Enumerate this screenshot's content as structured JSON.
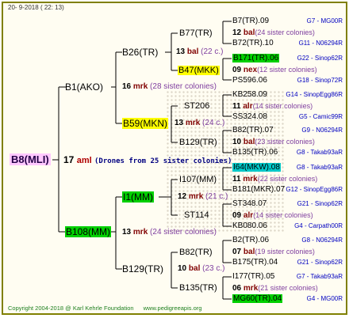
{
  "header": {
    "date": "20-  9-2018",
    "time": "( 22: 13)"
  },
  "root": {
    "name": "B8(MLI)",
    "generation": "17",
    "mark": "aml",
    "info": "(Drones from 25 sister colonies)"
  },
  "level1": [
    {
      "name": "B1(AKO)",
      "generation": "16",
      "mark": "mrk",
      "info": "(28 sister colonies)"
    },
    {
      "name": "B108(MM)",
      "generation": "13",
      "mark": "mrk",
      "info": "(24 sister colonies)"
    }
  ],
  "level2": [
    {
      "name": "B26(TR)",
      "generation": "13",
      "mark": "bal",
      "info": "(22 c.)"
    },
    {
      "name": "B59(MKN)",
      "generation": "13",
      "mark": "mrk",
      "info": "(24 c.)"
    },
    {
      "name": "I1(MM)",
      "generation": "12",
      "mark": "mrk",
      "info": "(21 c.)"
    },
    {
      "name": "B129(TR)",
      "generation": "10",
      "mark": "bal",
      "info": "(23 c.)"
    }
  ],
  "level3": [
    {
      "name": "B77(TR)"
    },
    {
      "name": "B47(MKK)"
    },
    {
      "name": "ST206"
    },
    {
      "name": "B129(TR)"
    },
    {
      "name": "I107(MM)"
    },
    {
      "name": "ST114"
    },
    {
      "name": "B82(TR)"
    },
    {
      "name": "B135(TR)"
    }
  ],
  "level4": [
    {
      "mother": "B7(TR).09",
      "gen": "12",
      "mark": "bal",
      "info": "(24 sister colonies)",
      "father": "B72(TR).10",
      "ref_m": "G7 - MG00R",
      "ref_f": "G11 - N06294R"
    },
    {
      "mother": "B171(TR).06",
      "gen": "09",
      "mark": "nex",
      "info": "(12 sister colonies)",
      "father": "PS596.06",
      "ref_m": "G22 - Sinop62R",
      "ref_f": "G18 - Sinop72R"
    },
    {
      "mother": "KB258.09",
      "gen": "11",
      "mark": "alr",
      "info": "(14 sister colonies)",
      "father": "SS324.08",
      "ref_m": "G14 - SinopEgg86R",
      "ref_f": "G5 - Camic99R"
    },
    {
      "mother": "B82(TR).07",
      "gen": "10",
      "mark": "bal",
      "info": "(23 sister colonies)",
      "father": "B135(TR).06",
      "ref_m": "G9 - N06294R",
      "ref_f": "G8 - Takab93aR"
    },
    {
      "mother": "I64(MKW).08",
      "gen": "11",
      "mark": "mrk",
      "info": "(22 sister colonies)",
      "father": "B181(MKR).07",
      "ref_m": "G8 - Takab93aR",
      "ref_f": "G12 - SinopEgg86R"
    },
    {
      "mother": "ST348.07",
      "gen": "09",
      "mark": "alr",
      "info": "(14 sister colonies)",
      "father": "KB080.06",
      "ref_m": "G21 - Sinop62R",
      "ref_f": "G4 - Carpath00R"
    },
    {
      "mother": "B2(TR).06",
      "gen": "07",
      "mark": "bal",
      "info": "(19 sister colonies)",
      "father": "B175(TR).04",
      "ref_m": "G8 - N06294R",
      "ref_f": "G21 - Sinop62R"
    },
    {
      "mother": "I177(TR).05",
      "gen": "06",
      "mark": "mrk",
      "info": "(21 sister colonies)",
      "father": "MG60(TR).04",
      "ref_m": "G7 - Takab93aR",
      "ref_f": "G4 - MG00R"
    }
  ],
  "footer": {
    "copyright": "Copyright 2004-2018 @ Karl Kehrle Foundation",
    "url": "www.pedigreeapis.org"
  },
  "colors": {
    "border": "#808000",
    "highlight_yellow": "#ffff00",
    "highlight_green": "#00d000",
    "highlight_cyan": "#00c8c8",
    "root_bg": "#ffc8ff",
    "mark": "#800000",
    "info": "#8040a0",
    "ref": "#0000c0"
  }
}
